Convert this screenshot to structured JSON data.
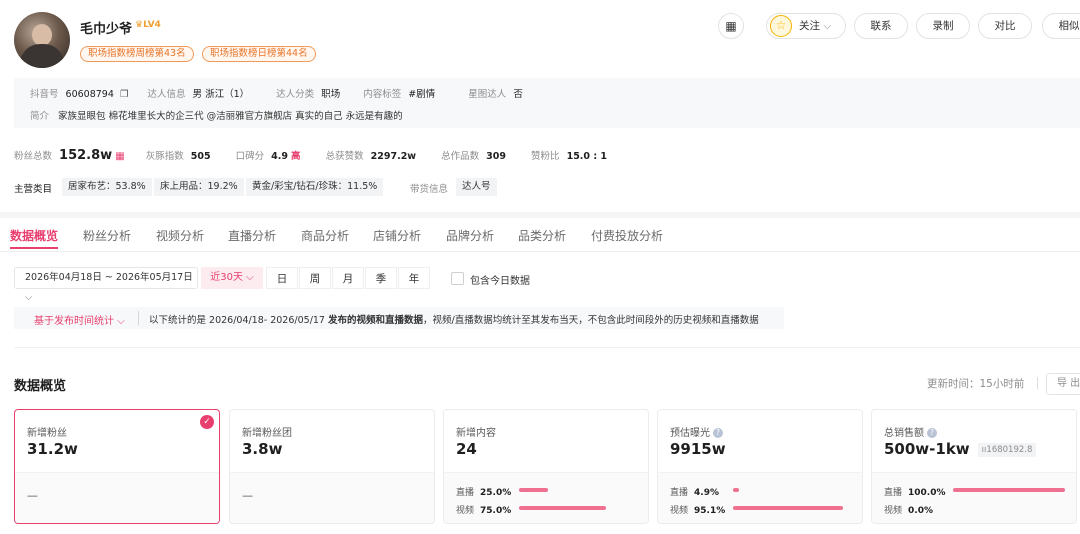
{
  "profile": {
    "name": "毛巾少爷",
    "level": "LV4",
    "ranks": [
      "职场指数榜周榜第43名",
      "职场指数榜日榜第44名"
    ]
  },
  "header_buttons": {
    "follow": "关注",
    "contact": "联系",
    "record": "录制",
    "compare": "对比",
    "similar": "相似"
  },
  "info": {
    "douyin_label": "抖音号",
    "douyin_value": "60608794",
    "talent_label": "达人信息",
    "talent_value": "男 浙江（1）",
    "category_label": "达人分类",
    "category_value": "职场",
    "content_label": "内容标签",
    "content_value": "#剧情",
    "star_label": "星图达人",
    "star_value": "否",
    "bio_label": "简介",
    "bio_value": "家族显眼包 棉花堆里长大的企三代 @洁丽雅官方旗舰店 真实的自己 永远是有趣的"
  },
  "stats": {
    "fans_label": "粉丝总数",
    "fans_value": "152.8w",
    "gray_label": "灰豚指数",
    "gray_value": "505",
    "rep_label": "口碑分",
    "rep_value": "4.9",
    "rep_level": "高",
    "likes_label": "总获赞数",
    "likes_value": "2297.2w",
    "works_label": "总作品数",
    "works_value": "309",
    "ratio_label": "赞粉比",
    "ratio_value": "15.0 : 1"
  },
  "categories": {
    "label": "主营类目",
    "items": [
      "居家布艺：53.8%",
      "床上用品：19.2%",
      "黄金/彩宝/钻石/珍珠：11.5%"
    ],
    "goods_label": "带货信息",
    "goods_value": "达人号"
  },
  "tabs": [
    "数据概览",
    "粉丝分析",
    "视频分析",
    "直播分析",
    "商品分析",
    "店铺分析",
    "品牌分析",
    "品类分析",
    "付费投放分析"
  ],
  "filters": {
    "date_range": "2026年04月18日 ~ 2026年05月17日",
    "preset": "近30天",
    "periods": [
      "日",
      "周",
      "月",
      "季",
      "年"
    ],
    "include_today": "包含今日数据",
    "basis": "基于发布时间统计",
    "notice_prefix": "以下统计的是 2026/04/18- 2026/05/17 ",
    "notice_bold": "发布的视频和直播数据",
    "notice_suffix": "，视频/直播数据均统计至其发布当天，不包含此时间段外的历史视频和直播数据"
  },
  "overview": {
    "title": "数据概览",
    "update_label": "更新时间：15小时前",
    "export_label": "导 出"
  },
  "cards": [
    {
      "title": "新增粉丝",
      "value": "31.2w",
      "foot": "—"
    },
    {
      "title": "新增粉丝团",
      "value": "3.8w",
      "foot": "—"
    },
    {
      "title": "新增内容",
      "value": "24",
      "rows": [
        {
          "label": "直播",
          "value": "25.0%",
          "ratio": 0.25
        },
        {
          "label": "视频",
          "value": "75.0%",
          "ratio": 0.75
        }
      ]
    },
    {
      "title": "预估曝光",
      "value": "9915w",
      "rows": [
        {
          "label": "直播",
          "value": "4.9%",
          "ratio": 0.049
        },
        {
          "label": "视频",
          "value": "95.1%",
          "ratio": 0.951
        }
      ]
    },
    {
      "title": "总销售额",
      "value": "500w-1kw",
      "raw": "1680192.8",
      "rows": [
        {
          "label": "直播",
          "value": "100.0%",
          "ratio": 1.0
        },
        {
          "label": "视频",
          "value": "0.0%",
          "ratio": 0.0
        }
      ]
    }
  ]
}
